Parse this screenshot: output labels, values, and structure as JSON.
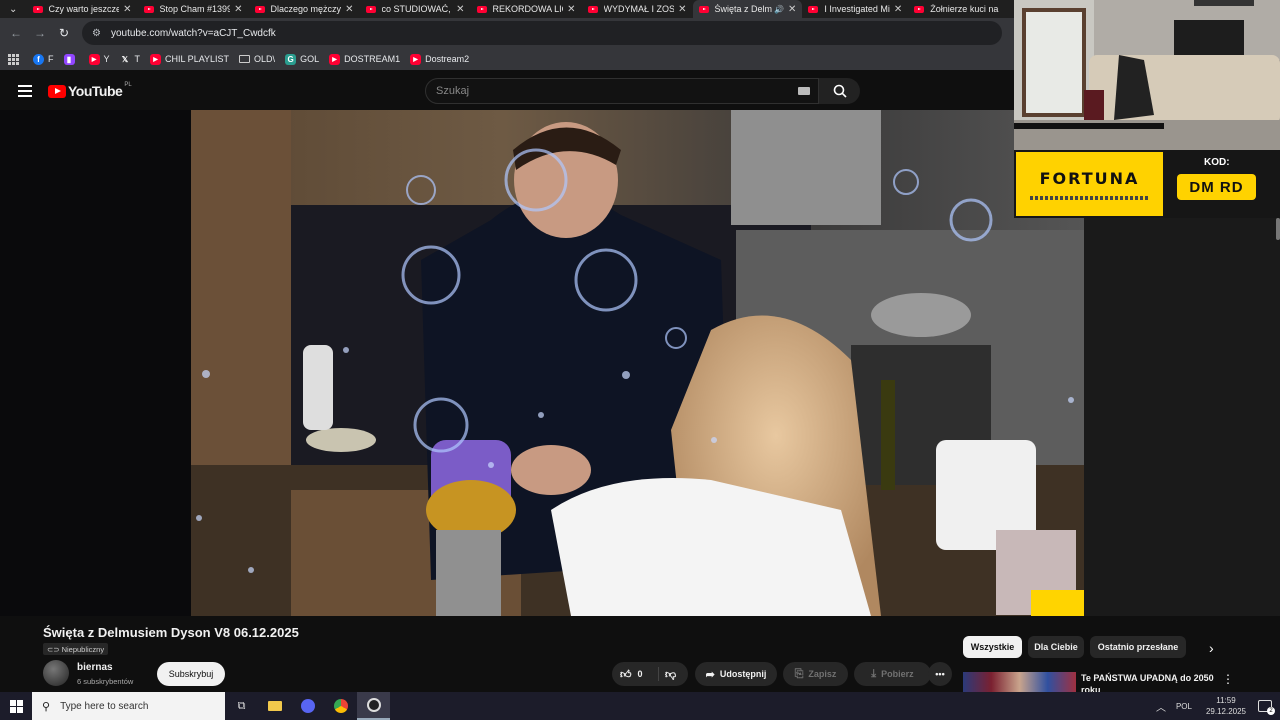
{
  "browser": {
    "tabs": [
      {
        "title": "Czy warto jeszcze",
        "active": false
      },
      {
        "title": "Stop Cham #1399",
        "active": false
      },
      {
        "title": "Dlaczego mężczyźni",
        "active": false
      },
      {
        "title": "co STUDIOWAĆ, a",
        "active": false
      },
      {
        "title": "REKORDOWA LICY",
        "active": false
      },
      {
        "title": "WYDYMAŁ I ZOST",
        "active": false
      },
      {
        "title": "Święta z Delm",
        "active": true
      },
      {
        "title": "I Investigated Mi",
        "active": false
      },
      {
        "title": "Żołnierze kuci na",
        "active": false
      }
    ],
    "url": "youtube.com/watch?v=aCJT_Cwdcfk",
    "bookmarks": [
      {
        "label": "F",
        "icon": "facebook-icon"
      },
      {
        "label": "",
        "icon": "twitch-icon"
      },
      {
        "label": "Y",
        "icon": "youtube-icon"
      },
      {
        "label": "T",
        "icon": "x-icon"
      },
      {
        "label": "CHIL PLAYLIST",
        "icon": "youtube-icon"
      },
      {
        "label": "OLD\\",
        "icon": "folder-icon"
      },
      {
        "label": "GOL",
        "icon": "gol-icon"
      },
      {
        "label": "DOSTREAM1",
        "icon": "youtube-icon"
      },
      {
        "label": "Dostream2",
        "icon": "youtube-icon"
      }
    ]
  },
  "youtube": {
    "logo_text": "YouTube",
    "logo_region": "PL",
    "search_placeholder": "Szukaj"
  },
  "overlay": {
    "sponsor_brand": "FORTUNA",
    "code_label": "KOD:",
    "code_value": "DM RD"
  },
  "video": {
    "title": "Święta z Delmusiem Dyson V8 06.12.2025",
    "visibility": "Niepubliczny",
    "channel": "biernas",
    "subscribers": "6 subskrybentów",
    "subscribe_label": "Subskrybuj",
    "likes": "0",
    "share_label": "Udostępnij",
    "save_label": "Zapisz",
    "download_label": "Pobierz"
  },
  "sidebar": {
    "chips": [
      "Wszystkie",
      "Dla Ciebie",
      "Ostatnio przesłane"
    ],
    "rec_title": "Te PAŃSTWA UPADNĄ do 2050 roku"
  },
  "taskbar": {
    "search_placeholder": "Type here to search",
    "language": "POL",
    "time": "11:59",
    "date": "29.12.2025",
    "notification_count": "2"
  },
  "colors": {
    "accent_red": "#ff0033",
    "sponsor_yellow": "#ffd200",
    "background": "#0f0f0f"
  }
}
